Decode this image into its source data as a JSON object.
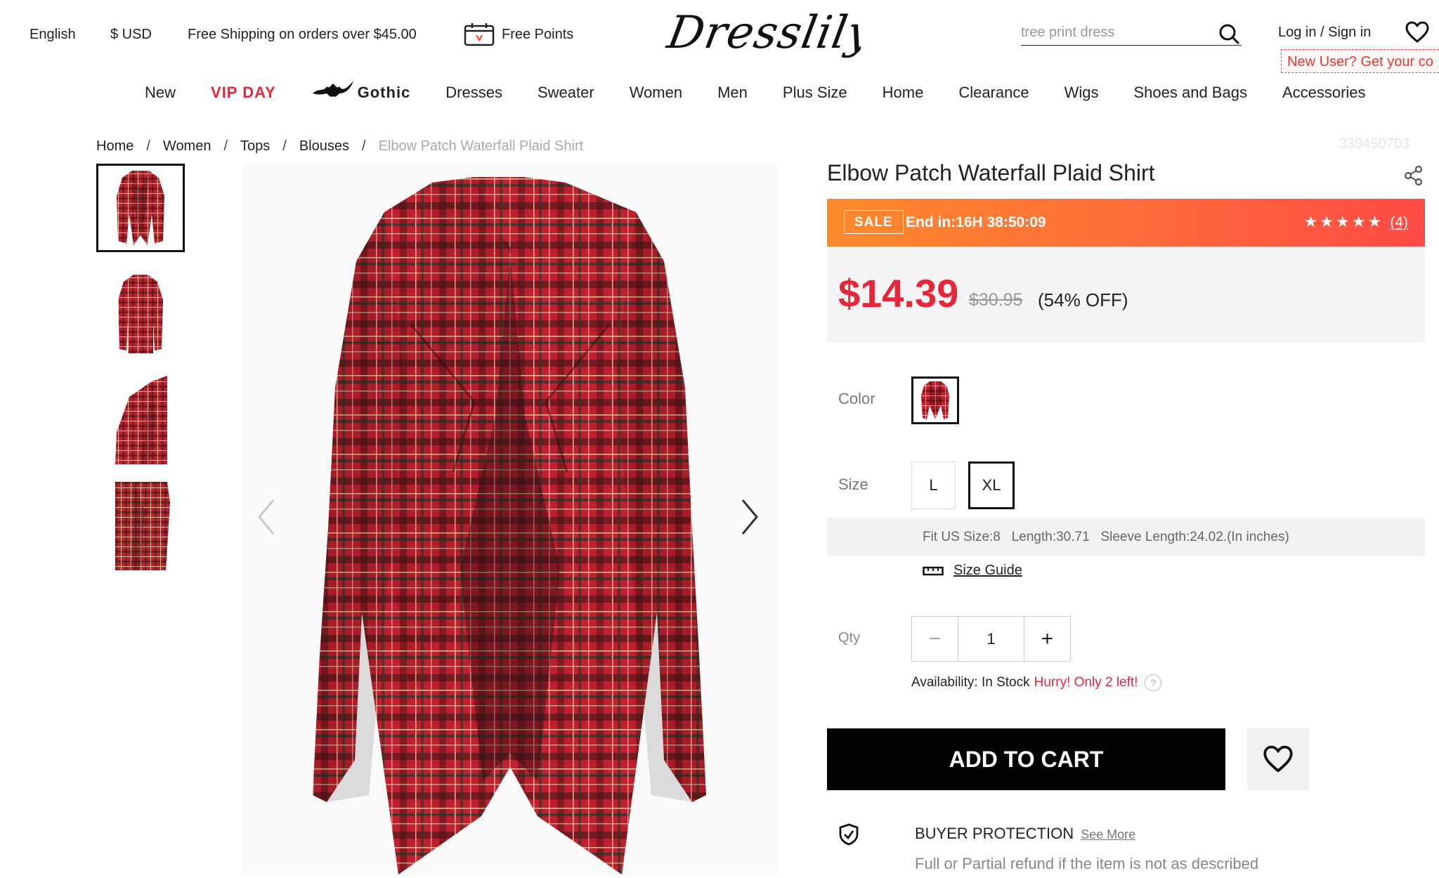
{
  "header": {
    "language": "English",
    "currency": "$ USD",
    "shipping_notice": "Free Shipping on orders over $45.00",
    "free_points": "Free Points",
    "logo": "Dresslily",
    "search_placeholder": "tree print dress",
    "login": "Log in / Sign in",
    "promo": "New User? Get your co"
  },
  "nav": {
    "items": [
      "New",
      "VIP DAY",
      "Gothic",
      "Dresses",
      "Sweater",
      "Women",
      "Men",
      "Plus Size",
      "Home",
      "Clearance",
      "Wigs",
      "Shoes and Bags",
      "Accessories"
    ]
  },
  "breadcrumb": {
    "items": [
      "Home",
      "Women",
      "Tops",
      "Blouses"
    ],
    "separator": "/",
    "current": "Elbow Patch Waterfall Plaid Shirt"
  },
  "product": {
    "sku": "339450703",
    "title": "Elbow Patch Waterfall Plaid Shirt",
    "sale_badge": "SALE",
    "sale_end": "End in:16H 38:50:09",
    "rating_stars": 5,
    "rating_count": "(4)",
    "price": "$14.39",
    "old_price": "$30.95",
    "discount": "(54% OFF)",
    "color_label": "Color",
    "size_label": "Size",
    "sizes": [
      "L",
      "XL"
    ],
    "selected_size": "XL",
    "fit_info": "Fit US Size:8   Length:30.71   Sleeve Length:24.02.(In inches)",
    "size_guide": "Size Guide",
    "qty_label": "Qty",
    "qty_value": "1",
    "availability_label": "Availability: In Stock",
    "availability_hurry": "Hurry! Only 2 left!",
    "add_to_cart": "ADD TO CART",
    "buyer_protection": "BUYER PROTECTION",
    "see_more": "See More",
    "buyer_protection_desc": "Full or Partial refund if the item is not as described"
  },
  "colors": {
    "accent_red": "#e8263a",
    "sale_gradient_start": "#ff8a2b",
    "sale_gradient_end": "#ff4a45",
    "plaid_red": "#c0202d"
  }
}
